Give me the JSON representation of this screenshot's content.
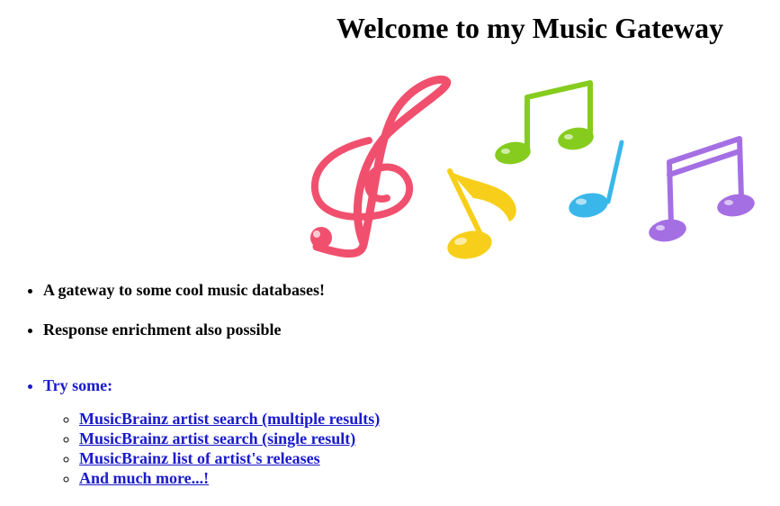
{
  "page": {
    "title": "Welcome to my Music Gateway"
  },
  "hero": {
    "icon": "music-notes-icon",
    "colors": {
      "treble_clef": "#f0506e",
      "eighth_note_yellow": "#f7cf1a",
      "beamed_notes_green": "#86cc1e",
      "eighth_note_blue": "#3ab7ea",
      "beamed_notes_purple": "#a56fe4"
    }
  },
  "features": [
    {
      "text": "A gateway to some cool music databases!"
    },
    {
      "text": "Response enrichment also possible"
    }
  ],
  "try_some": {
    "label": "Try some:",
    "links": [
      {
        "text": "MusicBrainz artist search (multiple results)"
      },
      {
        "text": "MusicBrainz artist search (single result)"
      },
      {
        "text": "MusicBrainz list of artist's releases"
      },
      {
        "text": "And much more...!"
      }
    ]
  },
  "colors": {
    "link": "#1a1acc",
    "text": "#000000",
    "background": "#ffffff"
  }
}
